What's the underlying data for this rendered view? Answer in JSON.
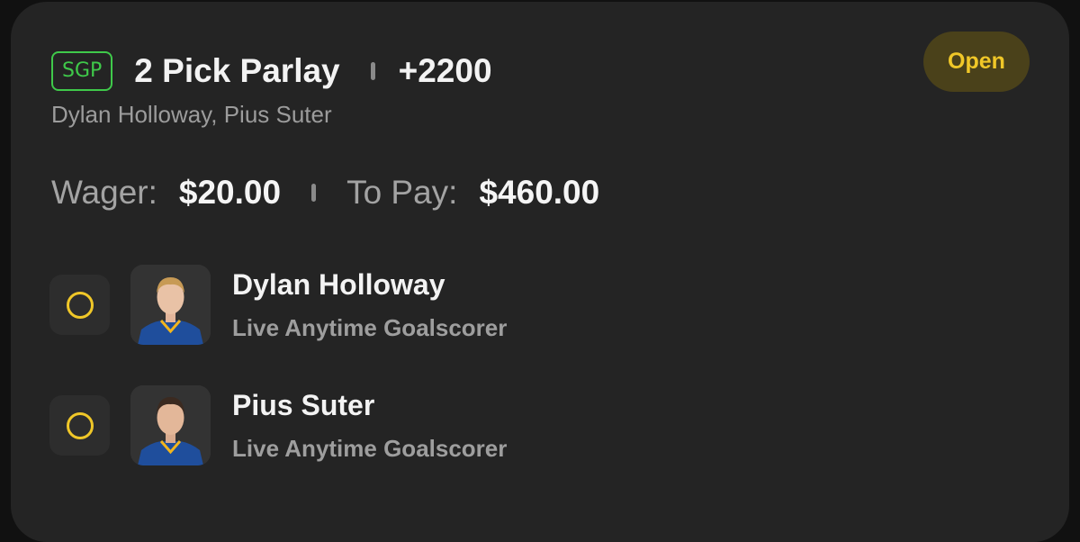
{
  "bet": {
    "badge": "SGP",
    "title": "2 Pick Parlay",
    "odds": "+2200",
    "players": "Dylan Holloway, Pius Suter",
    "status": "Open",
    "wager_label": "Wager:",
    "wager_value": "$20.00",
    "to_pay_label": "To Pay:",
    "to_pay_value": "$460.00"
  },
  "legs": [
    {
      "player": "Dylan Holloway",
      "market": "Live Anytime Goalscorer"
    },
    {
      "player": "Pius Suter",
      "market": "Live Anytime Goalscorer"
    }
  ],
  "colors": {
    "sgp_green": "#3fc94a",
    "status_yellow": "#f0c728",
    "card_bg": "#242424",
    "jersey_blue": "#1f4e9c"
  },
  "icons": {
    "leg_status": "circle-outline-icon",
    "player_photo": "player-headshot"
  }
}
